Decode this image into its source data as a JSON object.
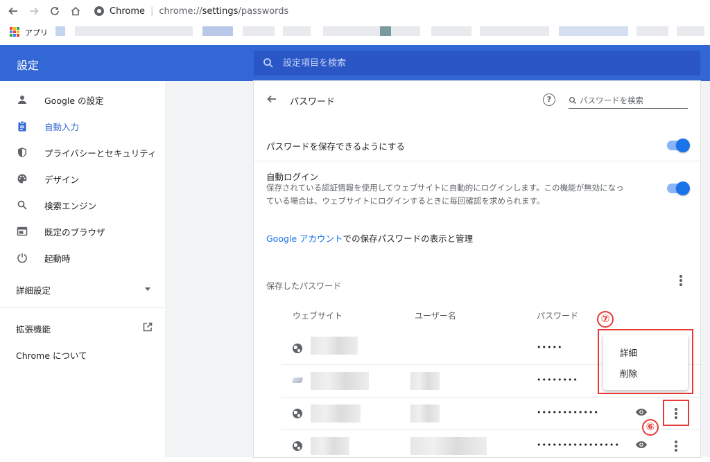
{
  "browser": {
    "origin": "Chrome",
    "url_scheme": "chrome://",
    "url_host": "settings",
    "url_path": "/passwords",
    "bookmarks_apps_label": "アプリ"
  },
  "header": {
    "title": "設定",
    "search_placeholder": "設定項目を検索"
  },
  "sidebar": {
    "items": [
      {
        "label": "Google の設定",
        "icon": "person-icon"
      },
      {
        "label": "自動入力",
        "icon": "clipboard-icon",
        "active": true
      },
      {
        "label": "プライバシーとセキュリティ",
        "icon": "shield-icon"
      },
      {
        "label": "デザイン",
        "icon": "palette-icon"
      },
      {
        "label": "検索エンジン",
        "icon": "search-icon"
      },
      {
        "label": "既定のブラウザ",
        "icon": "browser-window-icon"
      },
      {
        "label": "起動時",
        "icon": "power-icon"
      }
    ],
    "advanced": "詳細設定",
    "extensions": "拡張機能",
    "about": "Chrome について"
  },
  "passwords": {
    "title": "パスワード",
    "search_placeholder": "パスワードを検索",
    "offer_save": "パスワードを保存できるようにする",
    "auto_signin_title": "自動ログイン",
    "auto_signin_desc_1": "保存されている認証情報を使用してウェブサイトに自動的にログインします。この機能が無効になっ",
    "auto_signin_desc_2": "ている場合は、ウェブサイトにログインするときに毎回確認を求められます。",
    "account_link": "Google アカウント",
    "account_text": "での保存パスワードの表示と管理",
    "saved_heading": "保存したパスワード",
    "columns": {
      "website": "ウェブサイト",
      "username": "ユーザー名",
      "password": "パスワード"
    },
    "rows": [
      {
        "dots": "•••••"
      },
      {
        "dots": "••••••••"
      },
      {
        "dots": "••••••••••••"
      },
      {
        "dots": "••••••••••••••••"
      }
    ],
    "offer_save_enabled": true,
    "auto_signin_enabled": true
  },
  "menu": {
    "details": "詳細",
    "remove": "削除"
  },
  "annotations": {
    "step6": "⑥",
    "step7": "⑦"
  },
  "colors": {
    "header_blue": "#3367d6",
    "toggle_blue": "#1a73e8",
    "annotation_red": "#e53935"
  }
}
